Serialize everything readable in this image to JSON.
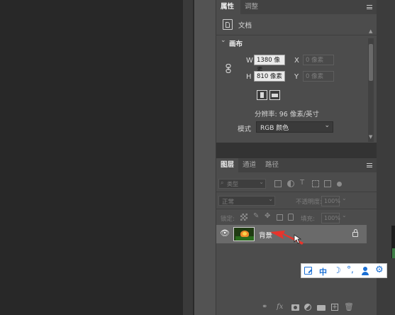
{
  "properties_panel": {
    "tabs": [
      "属性",
      "调整"
    ],
    "doc_label": "文档",
    "section_title": "画布",
    "width_label": "W",
    "width_value": "1380 像素",
    "x_label": "X",
    "x_placeholder": "0 像素",
    "height_label": "H",
    "height_value": "810 像素",
    "y_label": "Y",
    "y_placeholder": "0 像素",
    "resolution": "分辨率: 96 像素/英寸",
    "mode_label": "模式",
    "mode_value": "RGB 颜色"
  },
  "layers_panel": {
    "tabs": [
      "图层",
      "通道",
      "路径"
    ],
    "filter_placeholder": "类型",
    "blend_mode": "正常",
    "opacity_label": "不透明度:",
    "opacity_value": "100%",
    "lock_label": "锁定:",
    "fill_label": "填充:",
    "fill_value": "100%",
    "layers": [
      {
        "name": "背景",
        "visible": true,
        "locked": true
      }
    ],
    "footer_fx": "fx"
  },
  "ime_toolbar": {
    "mode_char": "中"
  },
  "colors": {
    "panel_bg": "#4c4c4c",
    "tab_bar_bg": "#424242",
    "workspace_bg": "#282828",
    "selected_layer": "#6a6a6a",
    "annotation_arrow": "#e8342c",
    "ime_blue": "#1a6fd4"
  }
}
